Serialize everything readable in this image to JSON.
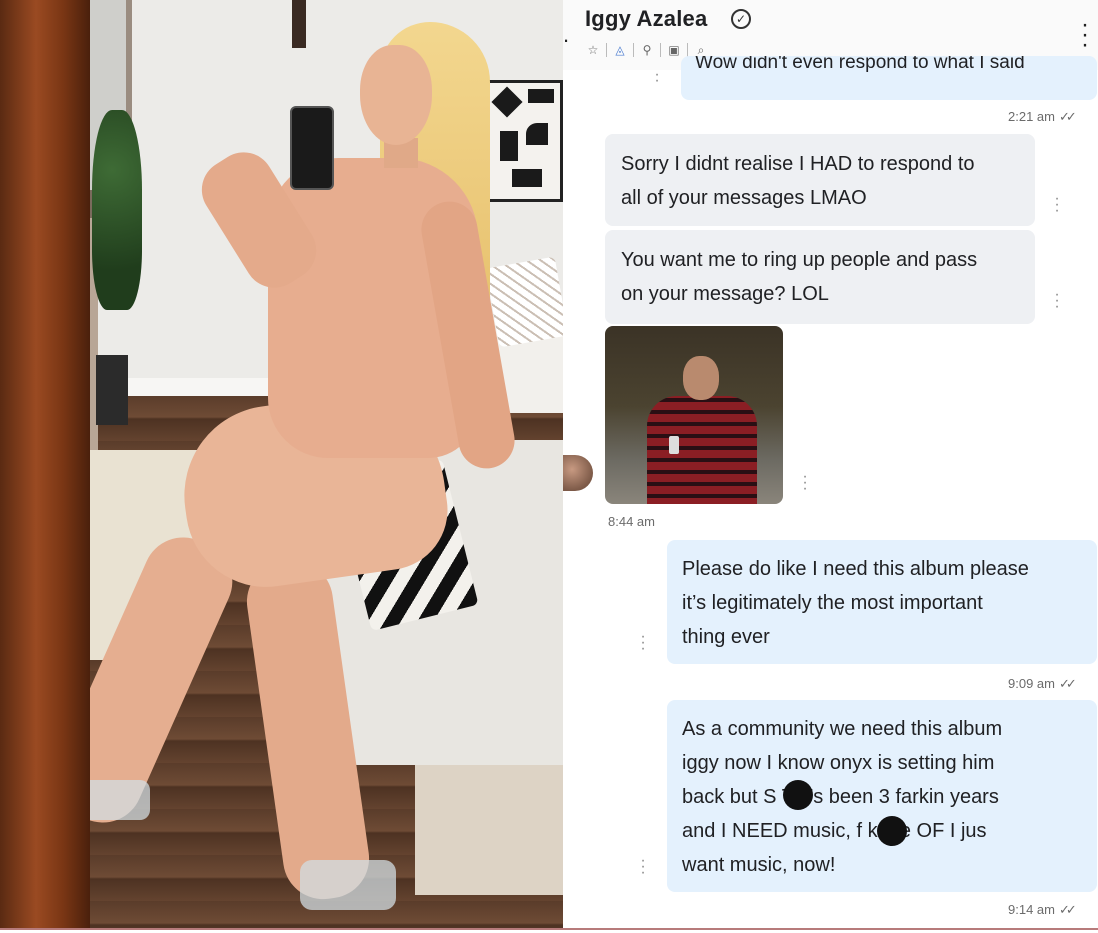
{
  "chat": {
    "contact_name": "Iggy Azalea",
    "verified_icon": "check-circle-icon",
    "header_tools": [
      "star-icon",
      "bell-icon",
      "pin-icon",
      "image-icon",
      "search-icon"
    ],
    "menu_icon": "kebab-menu-icon",
    "partial_message": "Wow didn't even respond to what I said",
    "partial_time": "2:21 am",
    "messages": [
      {
        "direction": "incoming",
        "lines": [
          "Sorry I didnt realise I HAD to respond to",
          "all of your messages LMAO"
        ]
      },
      {
        "direction": "incoming",
        "lines": [
          "You want me to ring up people and pass",
          "on your message? LOL"
        ]
      },
      {
        "direction": "incoming",
        "type": "photo",
        "time": "8:44 am"
      },
      {
        "direction": "outgoing",
        "lines": [
          "Please do like I need this album please",
          "it’s legitimately the most important",
          "thing ever"
        ],
        "time": "9:09 am"
      },
      {
        "direction": "outgoing",
        "lines": [
          "As a community we need this album",
          "iggy now I know onyx is setting him",
          "back but S   T it’s been 3 farkin years",
          "and I NEED music, f    k the OF I jus",
          "want music, now!"
        ],
        "time": "9:14 am"
      }
    ],
    "read_ticks": "✓✓"
  },
  "colors": {
    "incoming_bubble": "#eef0f3",
    "outgoing_bubble": "#e4f1fd",
    "accent": "#4a7bd0"
  }
}
